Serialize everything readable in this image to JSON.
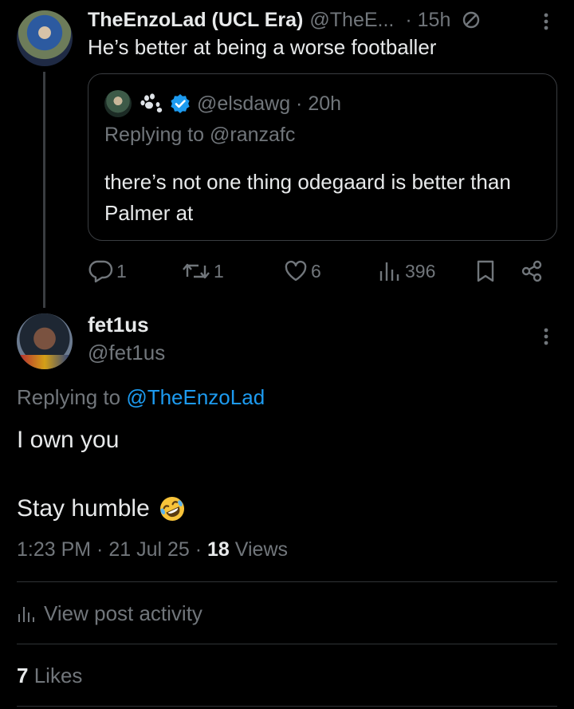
{
  "parent_tweet": {
    "display_name": "TheEnzoLad (UCL Era)",
    "handle": "@TheE...",
    "time": "· 15h",
    "text": "He’s better at being a worse footballer",
    "quoted_tweet": {
      "handle_time": "@elsdawg · 20h",
      "replying_to": "Replying to @ranzafc",
      "text": "there’s not one thing odegaard is better than Palmer at"
    },
    "actions": {
      "replies": "1",
      "reposts": "1",
      "likes": "6",
      "views": "396"
    }
  },
  "reply_tweet": {
    "display_name": "fet1us",
    "handle": "@fet1us",
    "replying_prefix": "Replying to",
    "replying_mention": "@TheEnzoLad",
    "line1": "I own you",
    "line2": "Stay humble",
    "meta_time": "1:23 PM · 21 Jul 25 · ",
    "views_count": "18",
    "views_label": "Views",
    "view_activity_label": "View post activity",
    "likes_count": "7",
    "likes_label": "Likes"
  },
  "colors": {
    "background": "#000000",
    "text": "#e7e9ea",
    "muted": "#71767b",
    "accent": "#1d9bf0",
    "border": "#2f3336"
  }
}
